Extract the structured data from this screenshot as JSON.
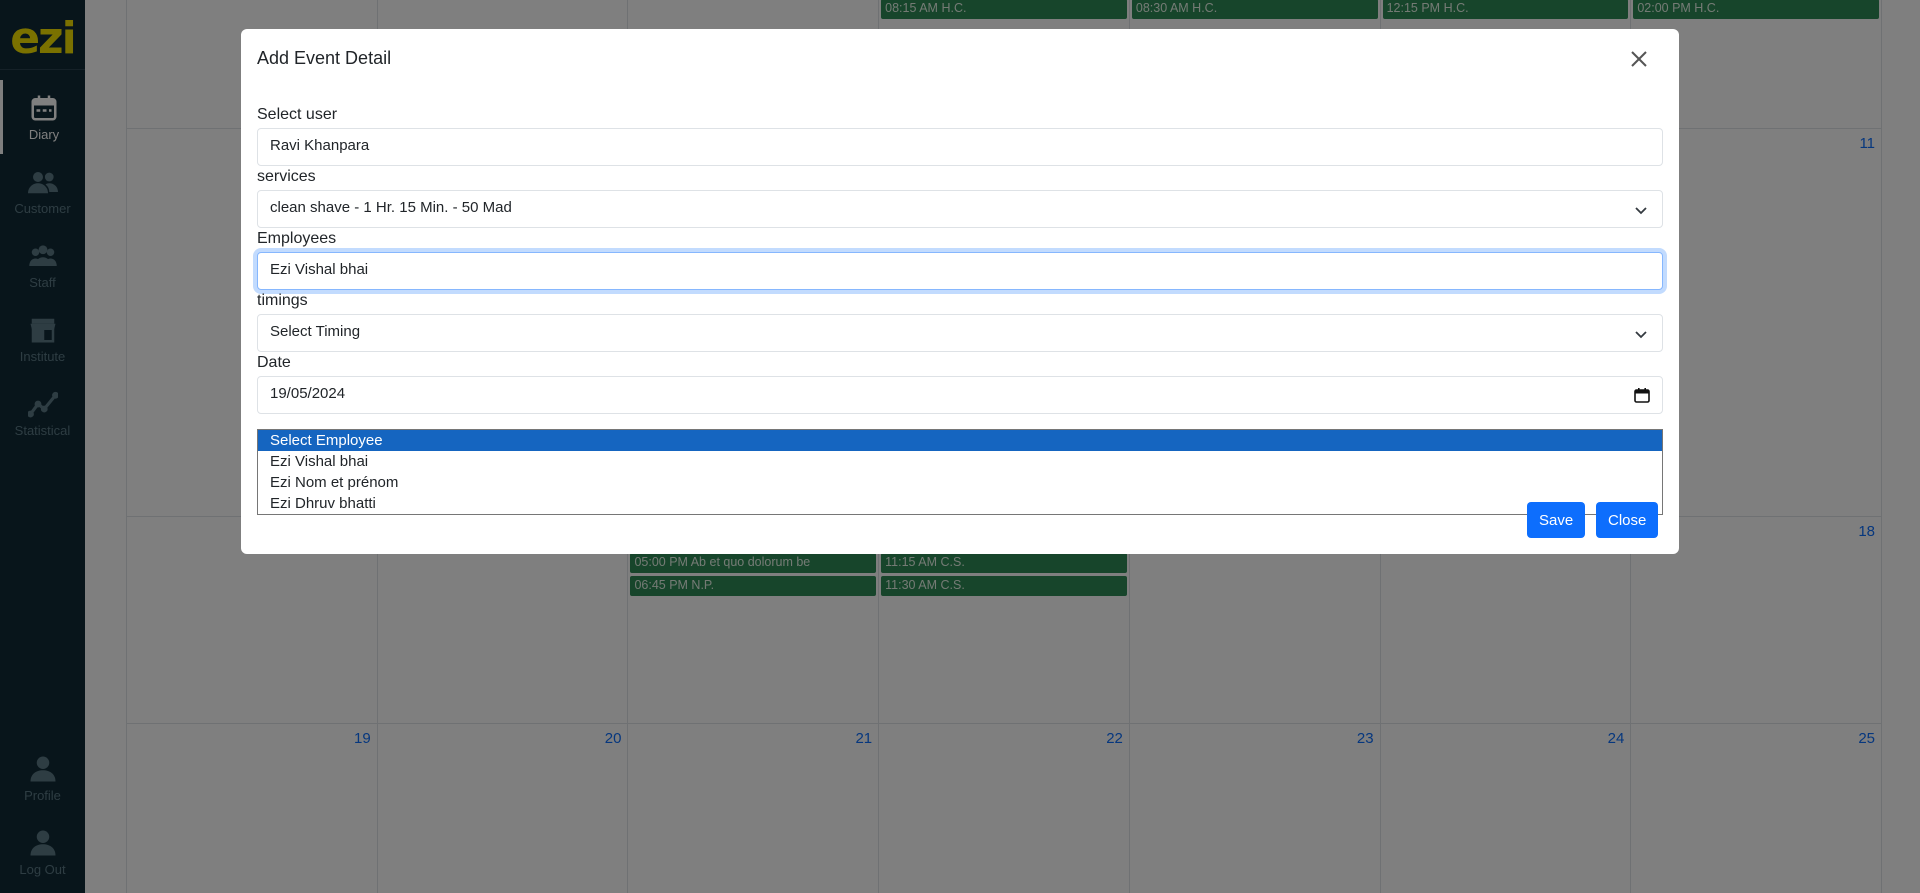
{
  "sidebar": {
    "logo": "ezi",
    "items": [
      {
        "label": "Diary",
        "icon": "calendar-icon",
        "active": true
      },
      {
        "label": "Customer",
        "icon": "customer-icon"
      },
      {
        "label": "Staff",
        "icon": "staff-icon"
      },
      {
        "label": "Institute",
        "icon": "institute-icon"
      },
      {
        "label": "Statistical",
        "icon": "statistics-icon"
      }
    ],
    "bottom": [
      {
        "label": "Profile",
        "icon": "profile-icon"
      },
      {
        "label": "Log Out",
        "icon": "logout-icon"
      }
    ]
  },
  "calendar": {
    "top_events": [
      "08:15 AM H.C.",
      "08:30 AM H.C.",
      "12:15 PM H.C.",
      "02:00 PM H.C."
    ],
    "week2_last_day": "11",
    "week3_last_day": "18",
    "week3_events_col3": [
      "05:00 PM Ab et quo dolorum be",
      "06:45 PM N.P."
    ],
    "week3_events_col4": [
      "11:15 AM C.S.",
      "11:30 AM C.S."
    ],
    "week4_days": [
      "19",
      "20",
      "21",
      "22",
      "23",
      "24",
      "25"
    ]
  },
  "modal": {
    "title": "Add Event Detail",
    "user_label": "Select user",
    "user_value": "Ravi Khanpara",
    "services_label": "services",
    "services_value": "clean shave - 1 Hr. 15 Min. - 50 Mad",
    "employees_label": "Employees",
    "employees_value": "Ezi Vishal bhai",
    "timings_label": "timings",
    "timings_value": "Select Timing",
    "date_label": "Date",
    "date_value": "19/05/2024",
    "employee_options": [
      "Select Employee",
      "Ezi Vishal bhai",
      "Ezi Nom et prénom",
      "Ezi Dhruv bhatti"
    ],
    "save_label": "Save",
    "close_label": "Close"
  }
}
